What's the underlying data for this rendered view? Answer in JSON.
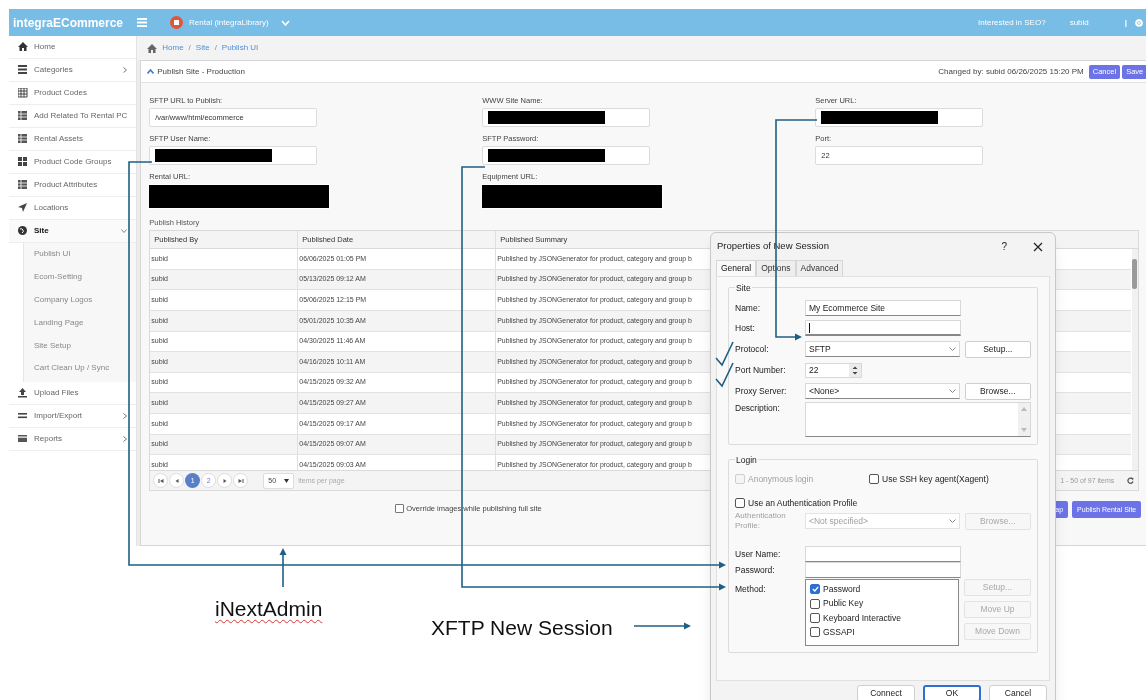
{
  "topbar": {
    "brand": "integraECommerce",
    "tenant": "Rental (integraLibrary)",
    "seo_link": "Interested in SEO?",
    "user": "subid",
    "separator": "|"
  },
  "sidebar": {
    "items": [
      {
        "label": "Home",
        "kind": "home",
        "selected": false
      },
      {
        "label": "Categories",
        "kind": "list",
        "selected": false,
        "arrow": true
      },
      {
        "label": "Product Codes",
        "kind": "grid",
        "selected": false
      },
      {
        "label": "Add Related To Rental PC",
        "kind": "table",
        "selected": false
      },
      {
        "label": "Rental Assets",
        "kind": "table",
        "selected": false
      },
      {
        "label": "Product Code Groups",
        "kind": "blocks",
        "selected": false
      },
      {
        "label": "Product Attributes",
        "kind": "table",
        "selected": false
      },
      {
        "label": "Locations",
        "kind": "send",
        "selected": false
      },
      {
        "label": "Site",
        "kind": "globe",
        "selected": true,
        "expanded": true,
        "children": [
          {
            "label": "Publish UI"
          },
          {
            "label": "Ecom-Setting"
          },
          {
            "label": "Company Logos"
          },
          {
            "label": "Landing Page"
          },
          {
            "label": "Site Setup"
          },
          {
            "label": "Cart Clean Up / Sync"
          }
        ]
      },
      {
        "label": "Upload Files",
        "kind": "upload",
        "selected": false
      },
      {
        "label": "Import/Export",
        "kind": "bars",
        "selected": false,
        "arrow": true
      },
      {
        "label": "Reports",
        "kind": "card",
        "selected": false,
        "arrow": true
      }
    ]
  },
  "breadcrumb": {
    "items": [
      "Home",
      "Site",
      "Publish UI"
    ],
    "separator": "/"
  },
  "panel": {
    "title": "Publish Site - Production",
    "changed_by": "Changed by: subid 06/26/2025 15:20 PM",
    "buttons": [
      "Cancel",
      "Save"
    ],
    "fields": [
      {
        "label": "SFTP URL to Publish:",
        "kind": "value",
        "value": "/var/www/html/ecommerce"
      },
      {
        "label": "WWW Site Name:",
        "kind": "redacted"
      },
      {
        "label": "Server URL:",
        "kind": "redacted"
      },
      {
        "label": "SFTP User Name:",
        "kind": "redacted"
      },
      {
        "label": "SFTP Password:",
        "kind": "redacted"
      },
      {
        "label": "Port:",
        "kind": "value",
        "value": "22"
      },
      {
        "label": "Rental URL:",
        "kind": "redacted_area"
      },
      {
        "label": "Equipment URL:",
        "kind": "redacted_area"
      }
    ],
    "history_label": "Publish History",
    "table": {
      "columns": [
        "Published By",
        "Published Date",
        "Published Summary"
      ],
      "rows": [
        [
          "subid",
          "06/06/2025 01:05 PM",
          "Published by JSONGenerator for product, category and group b"
        ],
        [
          "subid",
          "05/13/2025 09:12 AM",
          "Published by JSONGenerator for product, category and group b"
        ],
        [
          "subid",
          "05/06/2025 12:15 PM",
          "Published by JSONGenerator for product, category and group b"
        ],
        [
          "subid",
          "05/01/2025 10:35 AM",
          "Published by JSONGenerator for product, category and group b"
        ],
        [
          "subid",
          "04/30/2025 11:46 AM",
          "Published by JSONGenerator for product, category and group b"
        ],
        [
          "subid",
          "04/16/2025 10:11 AM",
          "Published by JSONGenerator for product, category and group b"
        ],
        [
          "subid",
          "04/15/2025 09:32 AM",
          "Published by JSONGenerator for product, category and group b"
        ],
        [
          "subid",
          "04/15/2025 09:27 AM",
          "Published by JSONGenerator for product, category and group b"
        ],
        [
          "subid",
          "04/15/2025 09:17 AM",
          "Published by JSONGenerator for product, category and group b"
        ],
        [
          "subid",
          "04/15/2025 09:07 AM",
          "Published by JSONGenerator for product, category and group b"
        ],
        [
          "subid",
          "04/15/2025 09:03 AM",
          "Published by JSONGenerator for product, category and group b"
        ]
      ]
    },
    "pager": {
      "pages": [
        {
          "label": "1",
          "selected": true
        },
        {
          "label": "2",
          "selected": false
        }
      ],
      "page_size": "50",
      "page_size_label": "items per page",
      "range": "1 - 50 of 97 items"
    },
    "override": {
      "label": "Override images while publishing full site",
      "checked": false
    },
    "actions": [
      "ap",
      "Publish Rental Site"
    ]
  },
  "dialog": {
    "title": "Properties of New Session",
    "help": "?",
    "tabs": [
      {
        "label": "General",
        "selected": true
      },
      {
        "label": "Options",
        "selected": false
      },
      {
        "label": "Advanced",
        "selected": false
      }
    ],
    "site": {
      "legend": "Site",
      "name_label": "Name:",
      "name": "My Ecommerce Site",
      "host_label": "Host:",
      "protocol_label": "Protocol:",
      "protocol": "SFTP",
      "setup": "Setup...",
      "port_label": "Port Number:",
      "port": "22",
      "proxy_label": "Proxy Server:",
      "proxy": "<None>",
      "browse": "Browse...",
      "description_label": "Description:"
    },
    "login": {
      "legend": "Login",
      "options": [
        {
          "label": "Anonymous login",
          "checked": false,
          "disabled": true
        },
        {
          "label": "Use SSH key agent(Xagent)",
          "checked": false,
          "disabled": false
        },
        {
          "label": "Use an Authentication Profile",
          "checked": false,
          "disabled": false
        }
      ],
      "profile_label": "Authentication Profile:",
      "profile": "<Not specified>",
      "profile_browse": "Browse...",
      "user_label": "User Name:",
      "password_label": "Password:",
      "method_label": "Method:",
      "methods": [
        {
          "label": "Password",
          "checked": true
        },
        {
          "label": "Public Key",
          "checked": false
        },
        {
          "label": "Keyboard Interactive",
          "checked": false
        },
        {
          "label": "GSSAPI",
          "checked": false
        }
      ],
      "method_buttons": [
        "Setup...",
        "Move Up",
        "Move Down"
      ]
    },
    "footer": [
      "Connect",
      "OK",
      "Cancel"
    ]
  },
  "annotations": {
    "admin_label": "iNextAdmin",
    "session_label": "XFTP New Session"
  }
}
